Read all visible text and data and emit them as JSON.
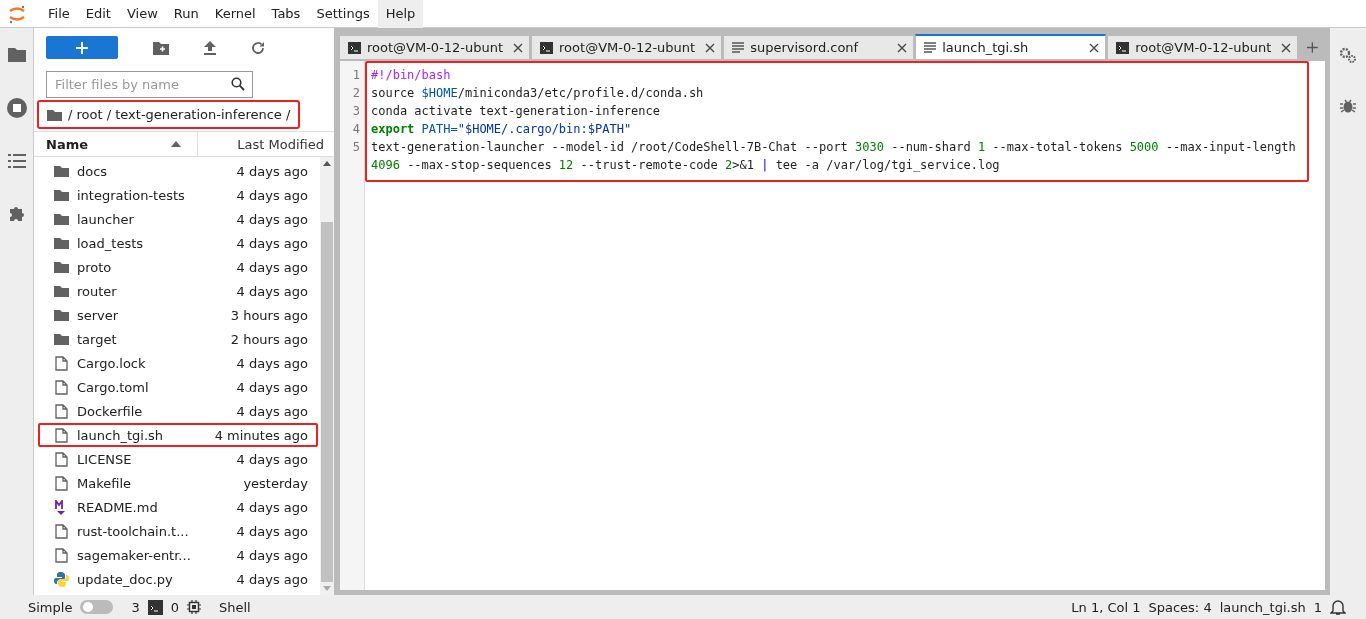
{
  "menu": [
    {
      "label": "File",
      "open": false
    },
    {
      "label": "Edit",
      "open": false
    },
    {
      "label": "View",
      "open": false
    },
    {
      "label": "Run",
      "open": false
    },
    {
      "label": "Kernel",
      "open": false
    },
    {
      "label": "Tabs",
      "open": false
    },
    {
      "label": "Settings",
      "open": false
    },
    {
      "label": "Help",
      "open": true
    }
  ],
  "file_browser": {
    "filter": {
      "placeholder": "Filter files by name"
    },
    "breadcrumb": {
      "text": "/ root / text-generation-inference /",
      "highlighted": true
    },
    "columns": [
      {
        "label": "Name",
        "sorted": true
      },
      {
        "label": "Last Modified",
        "sorted": false
      }
    ],
    "files": [
      {
        "name": "docs",
        "kind": "folder",
        "modified": "4 days ago",
        "highlighted": false
      },
      {
        "name": "integration-tests",
        "kind": "folder",
        "modified": "4 days ago",
        "highlighted": false
      },
      {
        "name": "launcher",
        "kind": "folder",
        "modified": "4 days ago",
        "highlighted": false
      },
      {
        "name": "load_tests",
        "kind": "folder",
        "modified": "4 days ago",
        "highlighted": false
      },
      {
        "name": "proto",
        "kind": "folder",
        "modified": "4 days ago",
        "highlighted": false
      },
      {
        "name": "router",
        "kind": "folder",
        "modified": "4 days ago",
        "highlighted": false
      },
      {
        "name": "server",
        "kind": "folder",
        "modified": "3 hours ago",
        "highlighted": false
      },
      {
        "name": "target",
        "kind": "folder",
        "modified": "2 hours ago",
        "highlighted": false
      },
      {
        "name": "Cargo.lock",
        "kind": "file",
        "modified": "4 days ago",
        "highlighted": false
      },
      {
        "name": "Cargo.toml",
        "kind": "file",
        "modified": "4 days ago",
        "highlighted": false
      },
      {
        "name": "Dockerfile",
        "kind": "file",
        "modified": "4 days ago",
        "highlighted": false
      },
      {
        "name": "launch_tgi.sh",
        "kind": "file",
        "modified": "4 minutes ago",
        "highlighted": true
      },
      {
        "name": "LICENSE",
        "kind": "file",
        "modified": "4 days ago",
        "highlighted": false
      },
      {
        "name": "Makefile",
        "kind": "file",
        "modified": "yesterday",
        "highlighted": false
      },
      {
        "name": "README.md",
        "kind": "markdown",
        "modified": "4 days ago",
        "highlighted": false
      },
      {
        "name": "rust-toolchain.t...",
        "kind": "file",
        "modified": "4 days ago",
        "highlighted": false
      },
      {
        "name": "sagemaker-entr...",
        "kind": "file",
        "modified": "4 days ago",
        "highlighted": false
      },
      {
        "name": "update_doc.py",
        "kind": "python",
        "modified": "4 days ago",
        "highlighted": false
      }
    ]
  },
  "tabs": [
    {
      "label": "root@VM-0-12-ubunt",
      "kind": "terminal",
      "selected": false
    },
    {
      "label": "root@VM-0-12-ubunt",
      "kind": "terminal",
      "selected": false
    },
    {
      "label": "supervisord.conf",
      "kind": "text",
      "selected": false
    },
    {
      "label": "launch_tgi.sh",
      "kind": "text",
      "selected": true
    },
    {
      "label": "root@VM-0-12-ubunt",
      "kind": "terminal",
      "selected": false
    }
  ],
  "editor": {
    "highlighted": true,
    "lines": [
      {
        "number": "1",
        "tokens": [
          {
            "kind": "comment",
            "text": "#!/bin/bash"
          }
        ]
      },
      {
        "number": "2",
        "tokens": [
          {
            "kind": "plain",
            "text": "source "
          },
          {
            "kind": "variable",
            "text": "$HOME"
          },
          {
            "kind": "plain",
            "text": "/miniconda3/etc/profile.d/conda.sh"
          }
        ]
      },
      {
        "number": "3",
        "tokens": [
          {
            "kind": "plain",
            "text": "conda activate text-generation-inference"
          }
        ]
      },
      {
        "number": "4",
        "tokens": [
          {
            "kind": "keyword",
            "text": "export"
          },
          {
            "kind": "variable",
            "text": " PATH="
          },
          {
            "kind": "string",
            "text": "\"$HOME/.cargo/bin:$PATH\""
          }
        ]
      },
      {
        "number": "5",
        "tokens": [
          {
            "kind": "plain",
            "text": "text-generation-launcher --model-id /root/CodeShell-7B-Chat --port "
          },
          {
            "kind": "number",
            "text": "3030"
          },
          {
            "kind": "plain",
            "text": " --num-shard "
          },
          {
            "kind": "number",
            "text": "1"
          },
          {
            "kind": "plain",
            "text": " --max-total-tokens "
          },
          {
            "kind": "number",
            "text": "5000"
          },
          {
            "kind": "plain",
            "text": " --max-input-length "
          },
          {
            "kind": "number",
            "text": "4096"
          },
          {
            "kind": "plain",
            "text": " --max-stop-sequences "
          },
          {
            "kind": "number",
            "text": "12"
          },
          {
            "kind": "plain",
            "text": " --trust-remote-code "
          },
          {
            "kind": "number",
            "text": "2"
          },
          {
            "kind": "plain",
            "text": ">&1 "
          },
          {
            "kind": "operator",
            "text": "|"
          },
          {
            "kind": "plain",
            "text": " tee -a /var/log/tgi_service.log"
          }
        ]
      }
    ]
  },
  "status_bar": {
    "mode_label": "Simple",
    "simple_mode": false,
    "terminals": "3",
    "kernels": "0",
    "kernel_name": "Shell",
    "cursor": "Ln 1, Col 1",
    "indent": "Spaces: 4",
    "file": "launch_tgi.sh",
    "notifications": "1"
  }
}
